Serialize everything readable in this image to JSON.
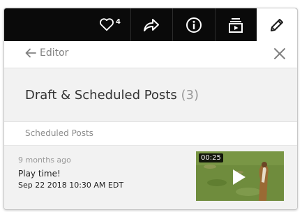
{
  "toolbar": {
    "like_count": "4",
    "icons": [
      "heart-icon",
      "share-icon",
      "info-icon",
      "present-icon",
      "pencil-icon"
    ],
    "active_button": "edit"
  },
  "nav": {
    "back_label": "Editor"
  },
  "header": {
    "title": "Draft & Scheduled Posts",
    "count": "(3)"
  },
  "section": {
    "label": "Scheduled Posts"
  },
  "posts": [
    {
      "relative_time": "9 months ago",
      "title": "Play time!",
      "scheduled": "Sep 22 2018 10:30 AM EDT",
      "video_duration": "00:25"
    }
  ],
  "colors": {
    "toolbar_bg": "#0a0a0a",
    "panel_bg": "#f2f2f2",
    "muted_text": "#8c8c8c"
  }
}
